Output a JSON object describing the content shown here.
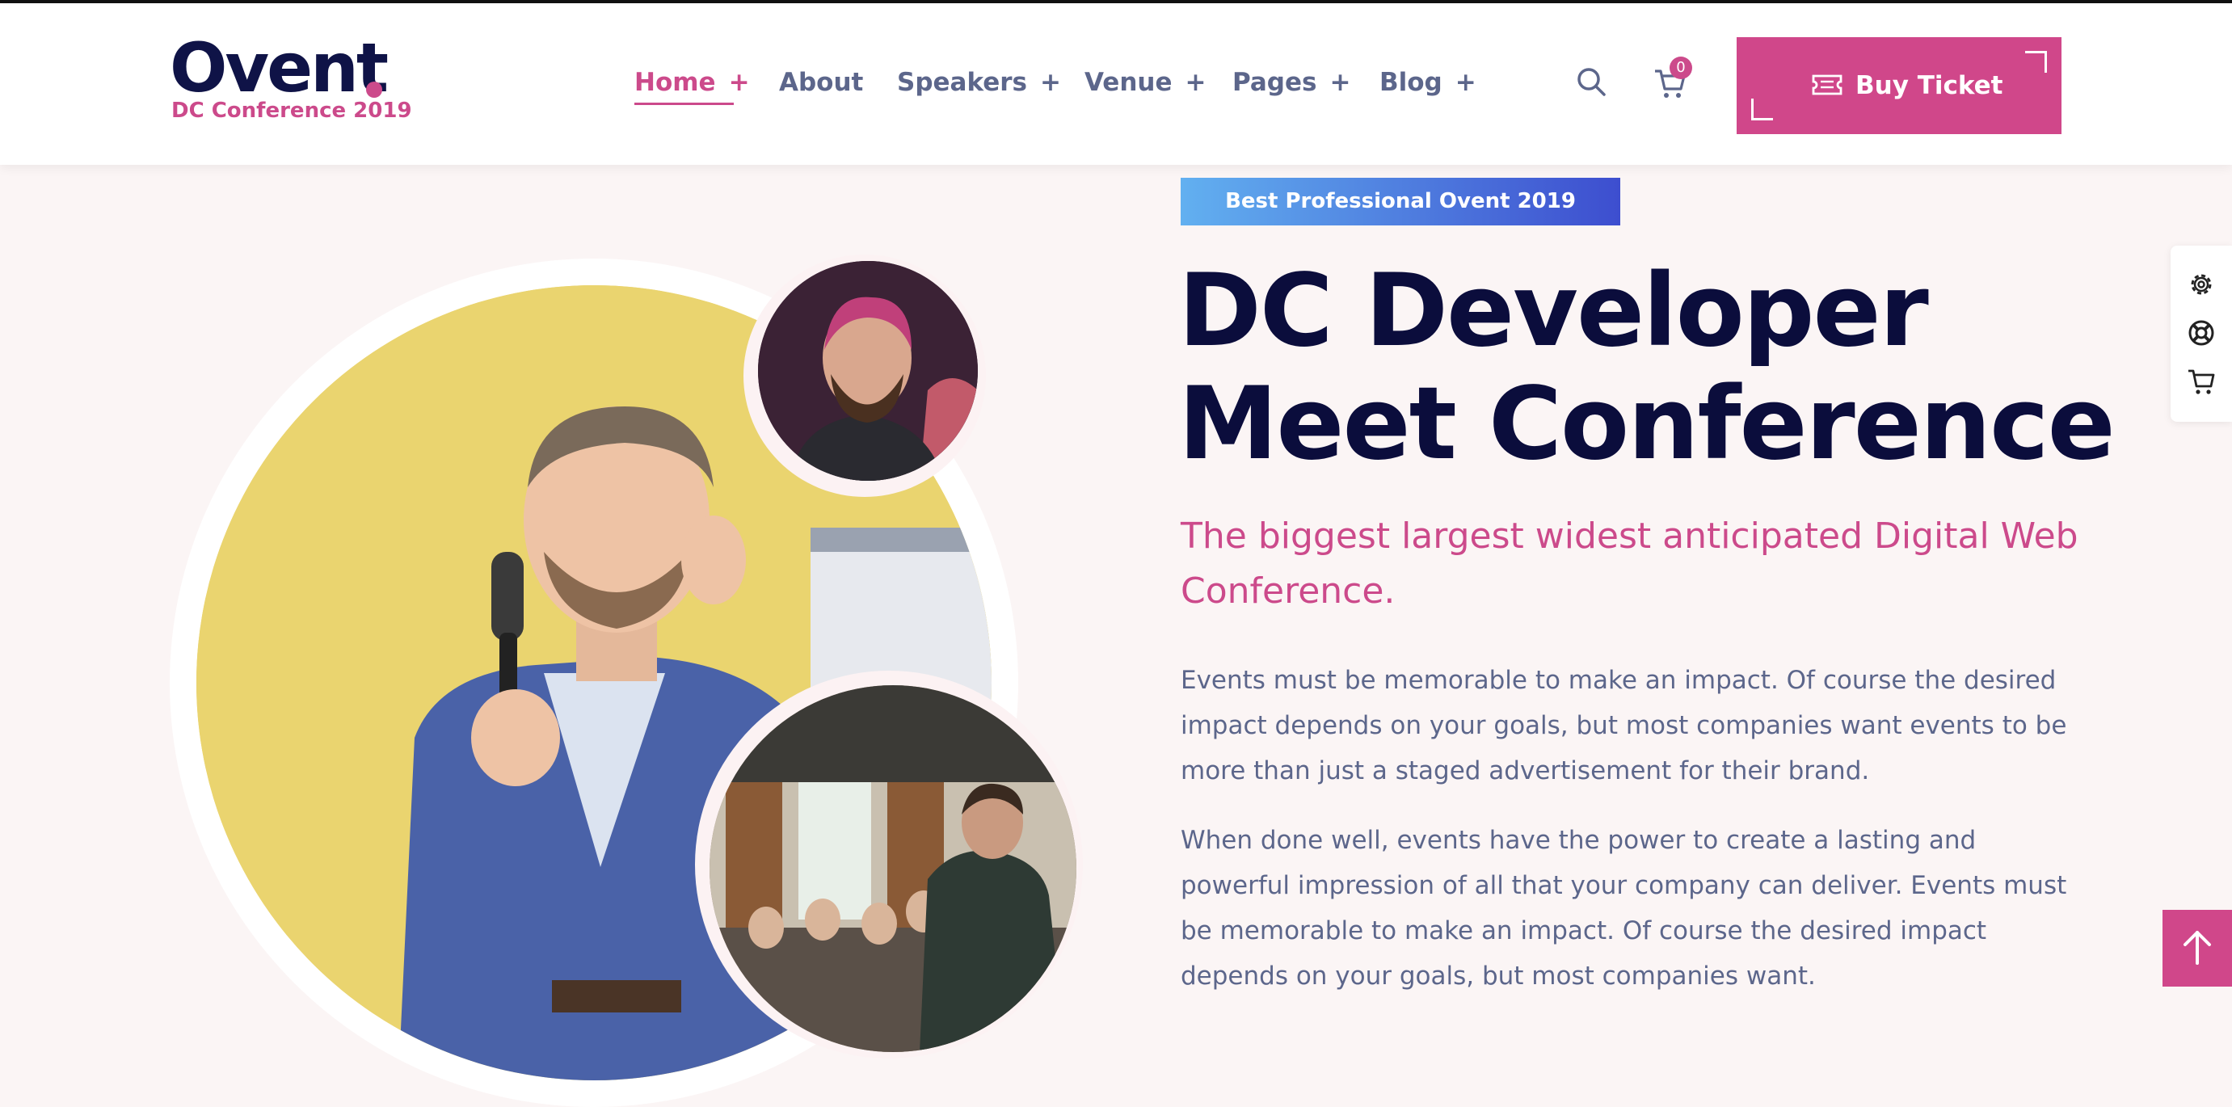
{
  "header": {
    "logo_text": "Ovent",
    "logo_subtitle": "DC Conference 2019",
    "nav": [
      {
        "label": "Home",
        "has_submenu": true,
        "active": true
      },
      {
        "label": "About",
        "has_submenu": false,
        "active": false
      },
      {
        "label": "Speakers",
        "has_submenu": true,
        "active": false
      },
      {
        "label": "Venue",
        "has_submenu": true,
        "active": false
      },
      {
        "label": "Pages",
        "has_submenu": true,
        "active": false
      },
      {
        "label": "Blog",
        "has_submenu": true,
        "active": false
      }
    ],
    "submenu_marker": "+",
    "cart_count": "0",
    "buy_button_label": "Buy Ticket",
    "icons": {
      "search": "search-icon",
      "cart": "cart-icon",
      "ticket": "ticket-icon"
    }
  },
  "hero": {
    "tag": "Best Professional Ovent 2019",
    "title_line1": "DC Developer",
    "title_line2": "Meet Conference",
    "subtitle": "The biggest largest widest anticipated Digital Web Conference.",
    "paragraph1": "Events must be memorable to make an impact. Of course the desired impact depends on your goals, but most companies want events to be more than just a staged advertisement for their brand.",
    "paragraph2": "When done well, events have the power to create a lasting and powerful impression of all that your company can deliver. Events must be memorable to make an impact. Of course the desired impact depends on your goals, but most companies want."
  },
  "side_panel": {
    "icons": [
      "gear-icon",
      "lifebuoy-icon",
      "cart-icon"
    ]
  },
  "scroll_top": {
    "icon": "arrow-up-icon"
  },
  "colors": {
    "accent": "#cc4a8b",
    "navy": "#0b0d3c",
    "body_text": "#5c668b",
    "background": "#fbf5f5",
    "tag_gradient_start": "#62b0f0",
    "tag_gradient_end": "#3d4ecf"
  }
}
